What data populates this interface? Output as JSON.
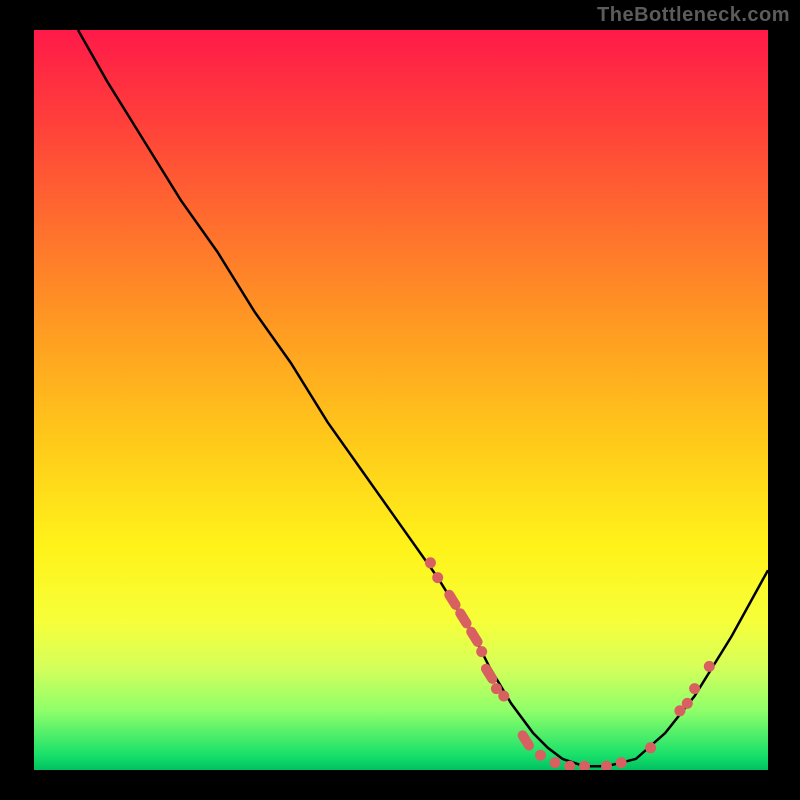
{
  "attribution": "TheBottleneck.com",
  "colors": {
    "dot": "#d86060",
    "curve": "#000000",
    "background": "#000000"
  },
  "chart_data": {
    "type": "line",
    "title": "",
    "xlabel": "",
    "ylabel": "",
    "xlim": [
      0,
      100
    ],
    "ylim": [
      0,
      100
    ],
    "grid": false,
    "legend": false,
    "series": [
      {
        "name": "bottleneck-curve",
        "x": [
          6,
          10,
          15,
          20,
          25,
          30,
          35,
          40,
          45,
          50,
          55,
          60,
          62,
          65,
          68,
          70,
          72,
          75,
          78,
          82,
          86,
          90,
          95,
          100
        ],
        "y": [
          100,
          93,
          85,
          77,
          70,
          62,
          55,
          47,
          40,
          33,
          26,
          18,
          14,
          9,
          5,
          3,
          1.5,
          0.5,
          0.5,
          1.5,
          5,
          10,
          18,
          27
        ]
      }
    ],
    "markers": [
      {
        "x": 54,
        "y": 28,
        "shape": "dot"
      },
      {
        "x": 55,
        "y": 26,
        "shape": "dot"
      },
      {
        "x": 57,
        "y": 23,
        "shape": "lozenge"
      },
      {
        "x": 58.5,
        "y": 20.5,
        "shape": "lozenge"
      },
      {
        "x": 60,
        "y": 18,
        "shape": "lozenge"
      },
      {
        "x": 61,
        "y": 16,
        "shape": "dot"
      },
      {
        "x": 62,
        "y": 13,
        "shape": "lozenge"
      },
      {
        "x": 63,
        "y": 11,
        "shape": "dot"
      },
      {
        "x": 64,
        "y": 10,
        "shape": "dot"
      },
      {
        "x": 67,
        "y": 4,
        "shape": "lozenge"
      },
      {
        "x": 69,
        "y": 2,
        "shape": "dot"
      },
      {
        "x": 71,
        "y": 1,
        "shape": "dot"
      },
      {
        "x": 73,
        "y": 0.5,
        "shape": "dot"
      },
      {
        "x": 75,
        "y": 0.5,
        "shape": "dot"
      },
      {
        "x": 78,
        "y": 0.5,
        "shape": "dot"
      },
      {
        "x": 80,
        "y": 1,
        "shape": "dot"
      },
      {
        "x": 84,
        "y": 3,
        "shape": "dot"
      },
      {
        "x": 88,
        "y": 8,
        "shape": "dot"
      },
      {
        "x": 89,
        "y": 9,
        "shape": "dot"
      },
      {
        "x": 90,
        "y": 11,
        "shape": "dot"
      },
      {
        "x": 92,
        "y": 14,
        "shape": "dot"
      }
    ]
  }
}
